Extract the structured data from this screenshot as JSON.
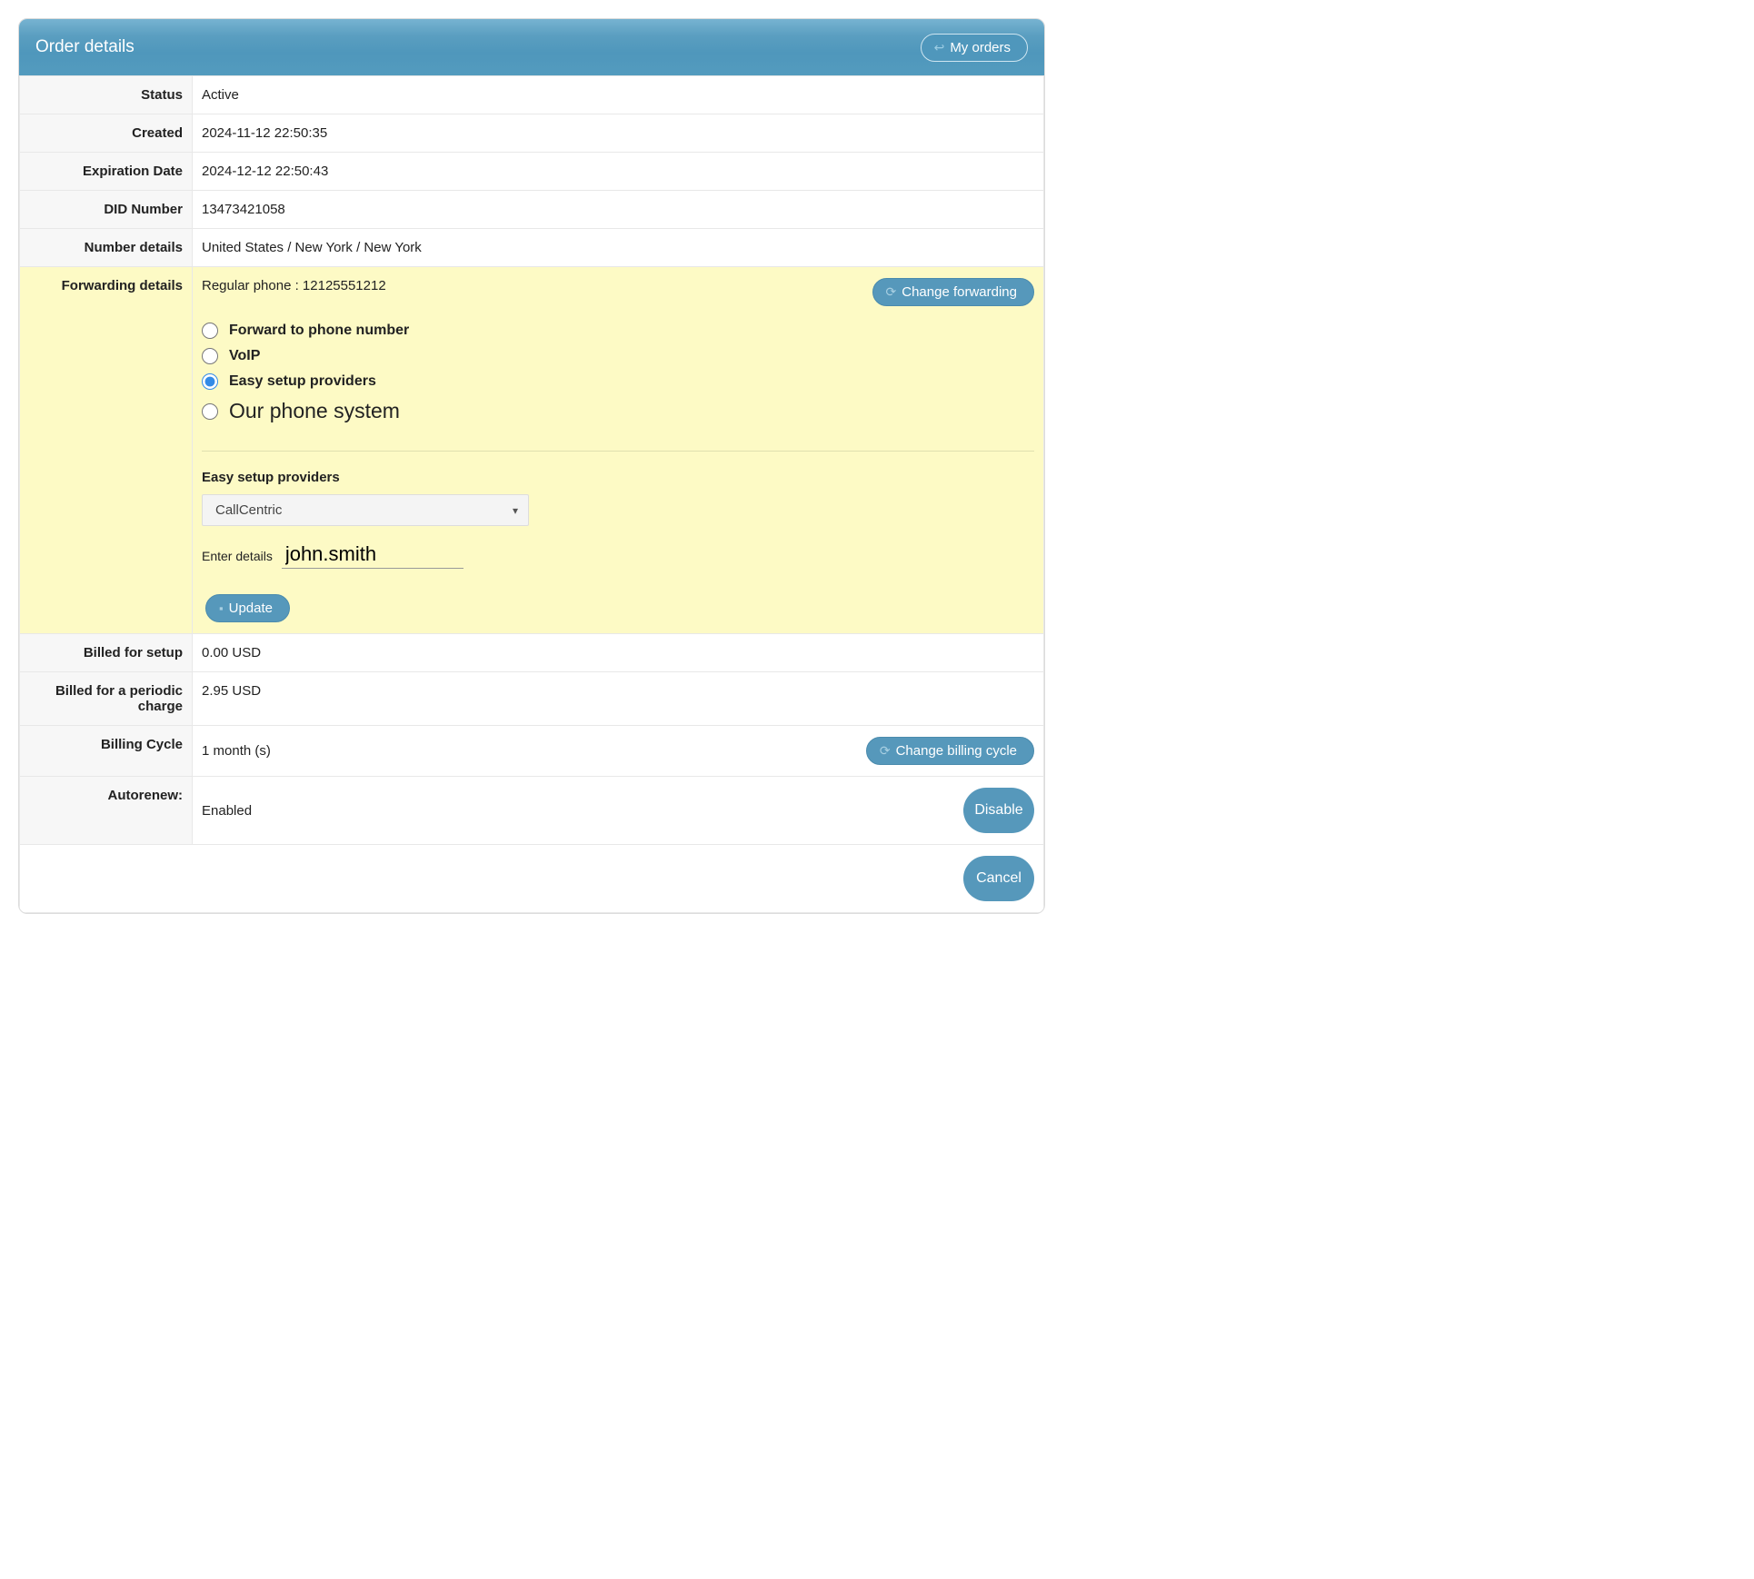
{
  "header": {
    "title": "Order details",
    "myorders_label": "My orders"
  },
  "rows": {
    "status_label": "Status",
    "status_value": "Active",
    "created_label": "Created",
    "created_value": "2024-11-12 22:50:35",
    "expiration_label": "Expiration Date",
    "expiration_value": "2024-12-12 22:50:43",
    "did_label": "DID Number",
    "did_value": "13473421058",
    "numdetails_label": "Number details",
    "numdetails_value": "United States / New York / New York",
    "fwd_label": "Forwarding details",
    "fwd_current": "Regular phone  : 12125551212",
    "change_forwarding_label": "Change forwarding",
    "radio_opts": {
      "phone": "Forward to phone number",
      "voip": "VoIP",
      "easy": "Easy setup providers",
      "oursystem": "Our phone system"
    },
    "easy_section_title": "Easy setup providers",
    "provider_selected": "CallCentric",
    "enter_details_label": "Enter details",
    "enter_details_value": "john.smith",
    "update_label": "Update",
    "billed_setup_label": "Billed for setup",
    "billed_setup_value": "0.00 USD",
    "billed_periodic_label": "Billed for a periodic charge",
    "billed_periodic_value": "2.95 USD",
    "billing_cycle_label": "Billing Cycle",
    "billing_cycle_value": "1 month (s)",
    "change_billing_label": "Change billing cycle",
    "autorenew_label": "Autorenew:",
    "autorenew_value": "Enabled",
    "disable_label": "Disable",
    "cancel_label": "Cancel"
  }
}
